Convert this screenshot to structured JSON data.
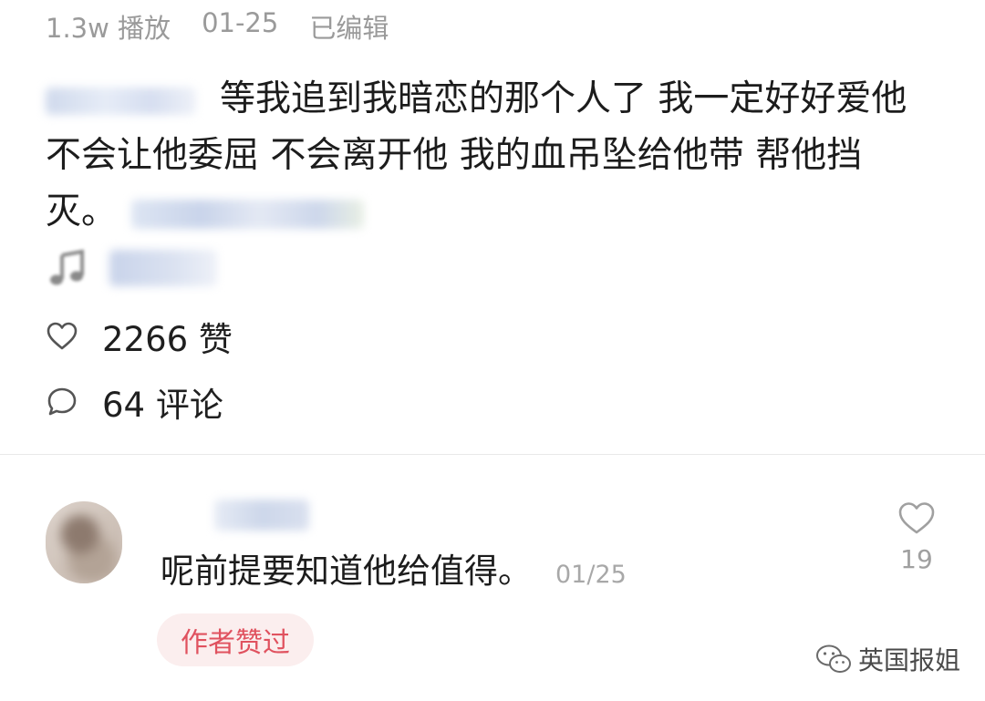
{
  "meta": {
    "plays": "1.3w 播放",
    "date": "01-25",
    "edited": "已编辑"
  },
  "post": {
    "text_line1": "等我追到我暗恋的那个人了 我一定好好爱他",
    "text_line2": "不会让他委屈 不会离开他 我的血吊坠给他带 帮他挡",
    "text_line3": "灭。"
  },
  "stats": {
    "likes": "2266 赞",
    "comments": "64 评论"
  },
  "comment": {
    "text": "呢前提要知道他给值得。",
    "date": "01/25",
    "like_count": "19",
    "author_liked": "作者赞过"
  },
  "watermark": {
    "text": "英国报姐"
  },
  "colors": {
    "accent": "#e0525f",
    "muted": "#9a9a9a",
    "chip_bg": "#fbeeee"
  }
}
